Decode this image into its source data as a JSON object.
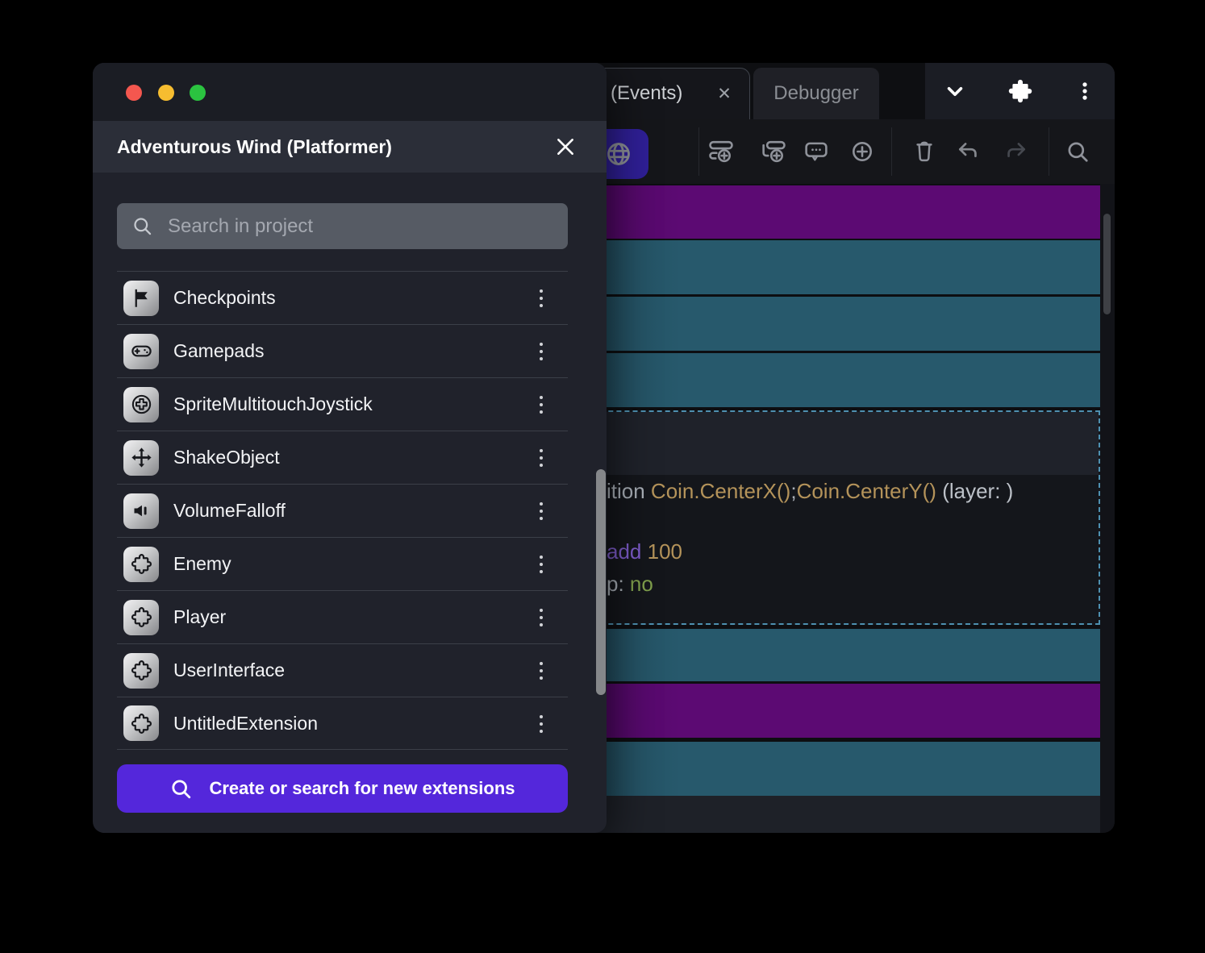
{
  "dialog": {
    "title": "Adventurous Wind (Platformer)",
    "search_placeholder": "Search in project",
    "items": [
      {
        "label": "Checkpoints",
        "icon": "flag-icon"
      },
      {
        "label": "Gamepads",
        "icon": "gamepad-icon"
      },
      {
        "label": "SpriteMultitouchJoystick",
        "icon": "joystick-icon"
      },
      {
        "label": "ShakeObject",
        "icon": "move-arrows-icon"
      },
      {
        "label": "VolumeFalloff",
        "icon": "speaker-icon"
      },
      {
        "label": "Enemy",
        "icon": "puzzle-icon"
      },
      {
        "label": "Player",
        "icon": "puzzle-icon"
      },
      {
        "label": "UserInterface",
        "icon": "puzzle-icon"
      },
      {
        "label": "UntitledExtension",
        "icon": "puzzle-icon"
      }
    ],
    "cta_label": "Create or search for new extensions"
  },
  "editor": {
    "tabs": [
      {
        "label": "(Events)",
        "close_glyph": "✕",
        "active": true
      },
      {
        "label": "Debugger",
        "active": false
      }
    ],
    "code": {
      "line1": [
        {
          "text": "ition "
        },
        {
          "text": "Coin.CenterX()"
        },
        {
          "text": ";"
        },
        {
          "text": "Coin.CenterY()"
        },
        {
          "text": " (layer: )"
        }
      ],
      "line2": [
        {
          "text": "add "
        },
        {
          "text": "100"
        }
      ],
      "line3": [
        {
          "text": "p: "
        },
        {
          "text": "no"
        }
      ]
    },
    "colors": {
      "accent_purple": "#5427db",
      "event_purple": "#5c0a73",
      "event_teal": "#27596c",
      "selection_border": "#4e90b0",
      "code_gold": "#b4935a",
      "code_keyword": "#7d5cc9",
      "code_green": "#7f9f4c"
    }
  }
}
